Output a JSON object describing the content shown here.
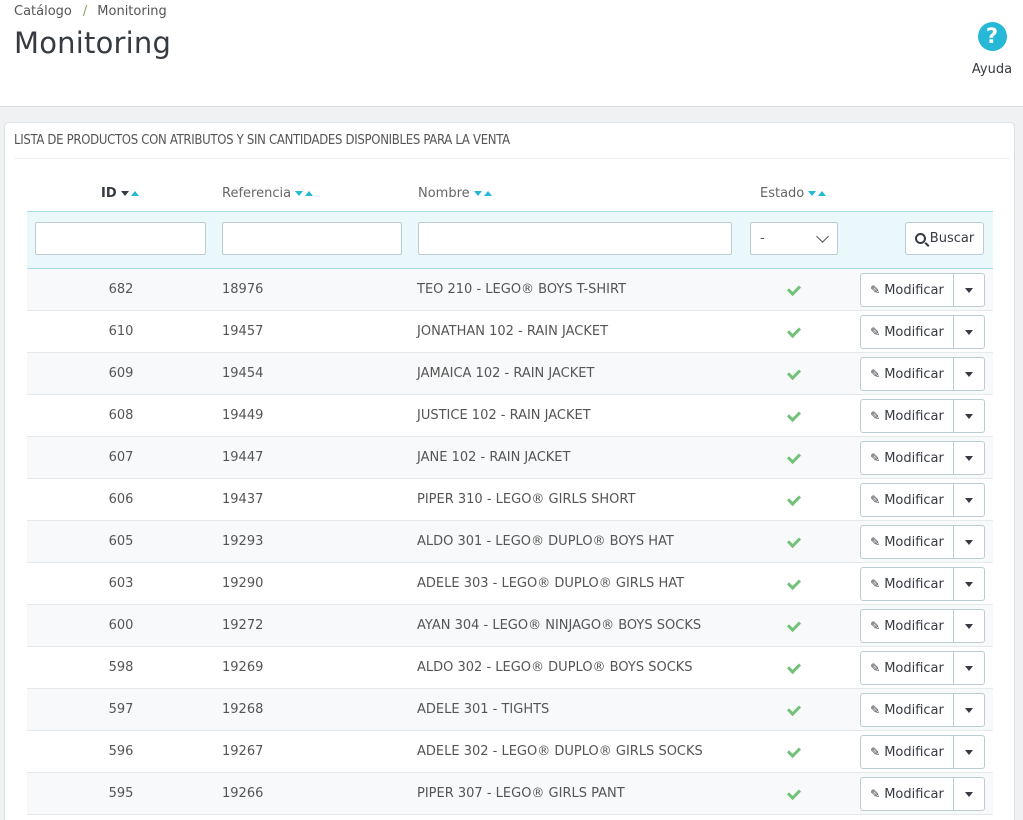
{
  "breadcrumb": {
    "parent": "Catálogo",
    "separator": "/",
    "current": "Monitoring"
  },
  "page": {
    "title": "Monitoring"
  },
  "help": {
    "icon": "?",
    "label": "Ayuda"
  },
  "panel": {
    "heading": "LISTA DE PRODUCTOS CON ATRIBUTOS Y SIN CANTIDADES DISPONIBLES PARA LA VENTA"
  },
  "columns": {
    "id": "ID",
    "reference": "Referencia",
    "name": "Nombre",
    "status": "Estado"
  },
  "filters": {
    "status_value": "-",
    "search_label": "Buscar"
  },
  "actions": {
    "edit_label": "Modificar"
  },
  "rows": [
    {
      "id": "682",
      "ref": "18976",
      "name": "TEO 210 - LEGO® BOYS T-SHIRT"
    },
    {
      "id": "610",
      "ref": "19457",
      "name": "JONATHAN 102 - RAIN JACKET"
    },
    {
      "id": "609",
      "ref": "19454",
      "name": "JAMAICA 102 - RAIN JACKET"
    },
    {
      "id": "608",
      "ref": "19449",
      "name": "JUSTICE 102 - RAIN JACKET"
    },
    {
      "id": "607",
      "ref": "19447",
      "name": "JANE 102 - RAIN JACKET"
    },
    {
      "id": "606",
      "ref": "19437",
      "name": "PIPER 310 - LEGO® GIRLS SHORT"
    },
    {
      "id": "605",
      "ref": "19293",
      "name": "ALDO 301 - LEGO® DUPLO® BOYS HAT"
    },
    {
      "id": "603",
      "ref": "19290",
      "name": "ADELE 303 - LEGO® DUPLO® GIRLS HAT"
    },
    {
      "id": "600",
      "ref": "19272",
      "name": "AYAN 304 - LEGO® NINJAGO® BOYS SOCKS"
    },
    {
      "id": "598",
      "ref": "19269",
      "name": "ALDO 302 - LEGO® DUPLO® BOYS SOCKS"
    },
    {
      "id": "597",
      "ref": "19268",
      "name": "ADELE 301 - TIGHTS"
    },
    {
      "id": "596",
      "ref": "19267",
      "name": "ADELE 302 - LEGO® DUPLO® GIRLS SOCKS"
    },
    {
      "id": "595",
      "ref": "19266",
      "name": "PIPER 307 - LEGO® GIRLS PANT"
    }
  ],
  "colors": {
    "accent": "#25b9d7",
    "check": "#72c279",
    "filter_bg": "#eaf7fb"
  }
}
